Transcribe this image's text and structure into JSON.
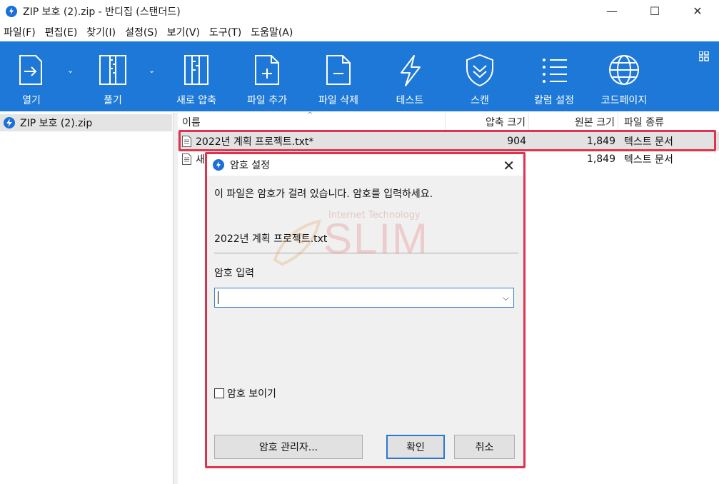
{
  "window": {
    "title": "ZIP 보호 (2).zip - 반디집 (스탠더드)",
    "minimize": "—",
    "maximize": "☐",
    "close": "✕"
  },
  "menu": [
    "파일(F)",
    "편집(E)",
    "찾기(I)",
    "설정(S)",
    "보기(V)",
    "도구(T)",
    "도움말(A)"
  ],
  "toolbar": {
    "open": "열기",
    "extract": "풀기",
    "new_archive": "새로 압축",
    "add_file": "파일 추가",
    "delete_file": "파일 삭제",
    "test": "테스트",
    "scan": "스캔",
    "columns": "칼럼 설정",
    "codepage": "코드페이지"
  },
  "tree": {
    "root": "ZIP 보호 (2).zip"
  },
  "list": {
    "headers": {
      "name": "이름",
      "compressed": "압축 크기",
      "original": "원본 크기",
      "type": "파일 종류"
    },
    "rows": [
      {
        "name": "2022년 계획 프로젝트.txt*",
        "compressed": "904",
        "original": "1,849",
        "type": "텍스트 문서"
      },
      {
        "name": "새",
        "compressed": "",
        "original": "1,849",
        "type": "텍스트 문서"
      }
    ]
  },
  "dialog": {
    "title": "암호 설정",
    "close": "✕",
    "message": "이 파일은 암호가 걸려 있습니다. 암호를 입력하세요.",
    "filename": "2022년 계획 프로젝트.txt",
    "password_label": "암호 입력",
    "password_value": "",
    "show_password": "암호 보이기",
    "manager_button": "암호 관리자...",
    "ok_button": "확인",
    "cancel_button": "취소"
  },
  "watermark": {
    "line1": "Internet Technology",
    "line2": "SLIM"
  },
  "colors": {
    "toolbar": "#1e78d7",
    "highlight": "#e0334d",
    "accent": "#2a78d4"
  }
}
